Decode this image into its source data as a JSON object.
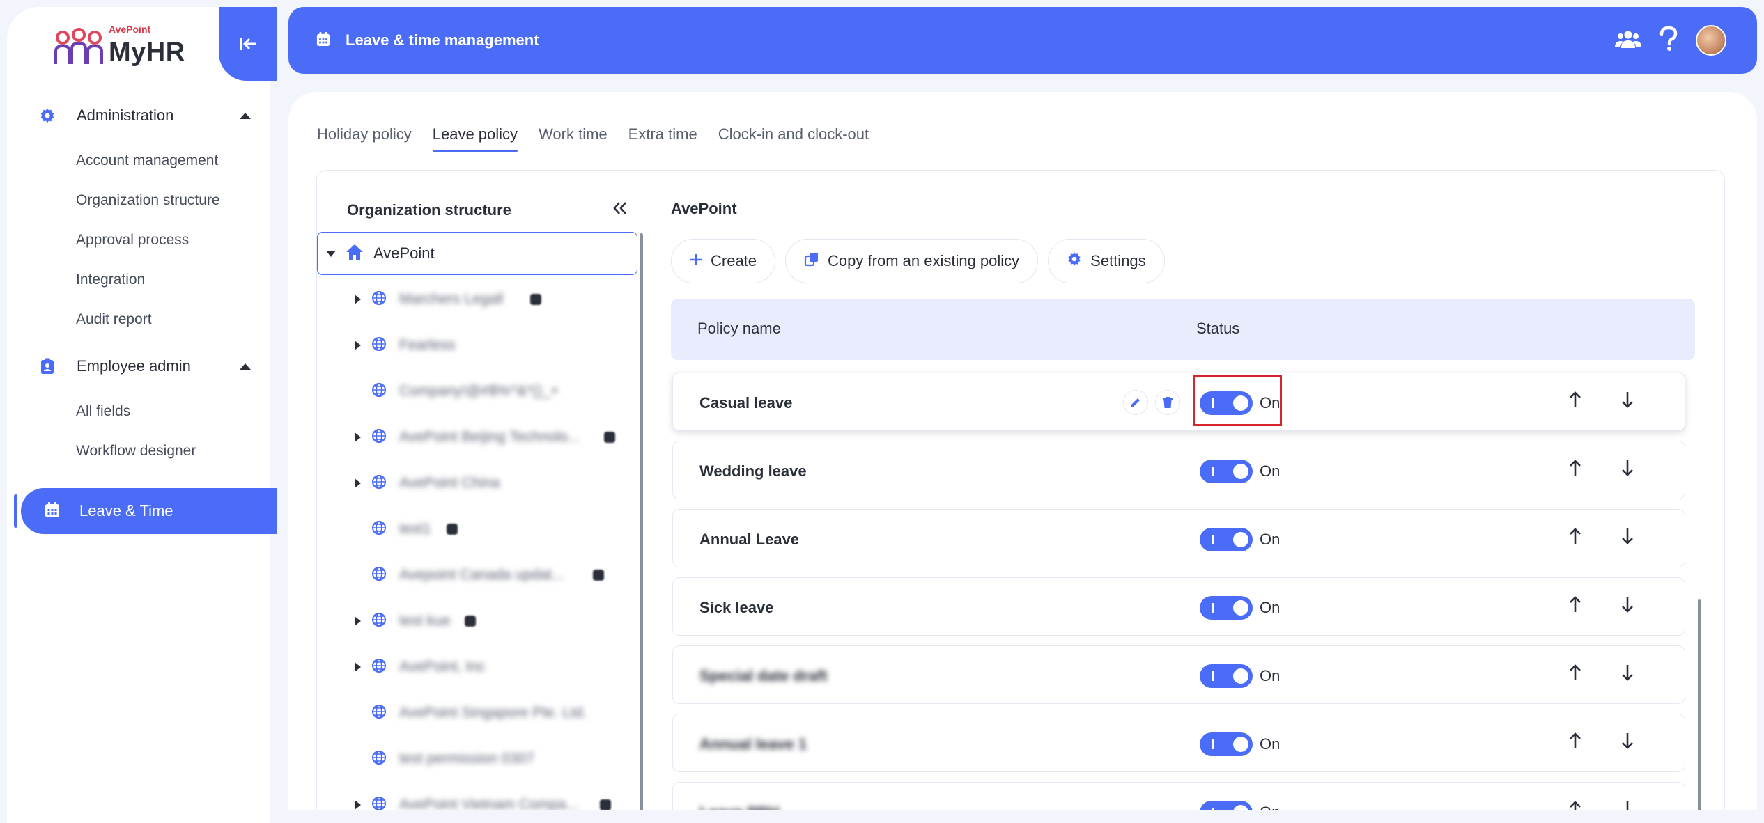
{
  "brand": {
    "company_small": "AvePoint",
    "app_name": "MyHR"
  },
  "sidebar": {
    "groups": [
      {
        "label": "Administration",
        "items": [
          "Account management",
          "Organization structure",
          "Approval process",
          "Integration",
          "Audit report"
        ]
      },
      {
        "label": "Employee admin",
        "items": [
          "All fields",
          "Workflow designer"
        ]
      }
    ],
    "active": {
      "label": "Leave & Time"
    }
  },
  "header": {
    "title": "Leave & time management"
  },
  "tabs": [
    "Holiday policy",
    "Leave policy",
    "Work time",
    "Extra time",
    "Clock-in and clock-out"
  ],
  "active_tab": "Leave policy",
  "org_tree": {
    "title": "Organization structure",
    "root": "AvePoint",
    "children": [
      {
        "label": "Marchers Legall"
      },
      {
        "label": "Fearless"
      },
      {
        "label": "Company!@#$%^&*()_+"
      },
      {
        "label": "AvePoint Beijing Technolo..."
      },
      {
        "label": "AvePoint China"
      },
      {
        "label": "test1"
      },
      {
        "label": "Avepoint Canada updat..."
      },
      {
        "label": "test kue"
      },
      {
        "label": "AvePoint, Inc"
      },
      {
        "label": "AvePoint Singapore Pte. Ltd."
      },
      {
        "label": "test permission 0307"
      },
      {
        "label": "AvePoint Vietnam Compa..."
      }
    ]
  },
  "policy_panel": {
    "breadcrumb": "AvePoint",
    "buttons": {
      "create": "Create",
      "copy": "Copy from an existing policy",
      "settings": "Settings"
    },
    "columns": {
      "name": "Policy name",
      "status": "Status"
    },
    "rows": [
      {
        "name": "Casual leave",
        "status": "On"
      },
      {
        "name": "Wedding leave",
        "status": "On"
      },
      {
        "name": "Annual Leave",
        "status": "On"
      },
      {
        "name": "Sick leave",
        "status": "On"
      },
      {
        "name": "Special date draft",
        "status": "On"
      },
      {
        "name": "Annual leave 1",
        "status": "On"
      },
      {
        "name": "Leave PRH",
        "status": "On"
      }
    ]
  },
  "colors": {
    "accent": "#4a6cf7",
    "highlight": "#d9232e",
    "header_row": "#e8ecfd"
  }
}
